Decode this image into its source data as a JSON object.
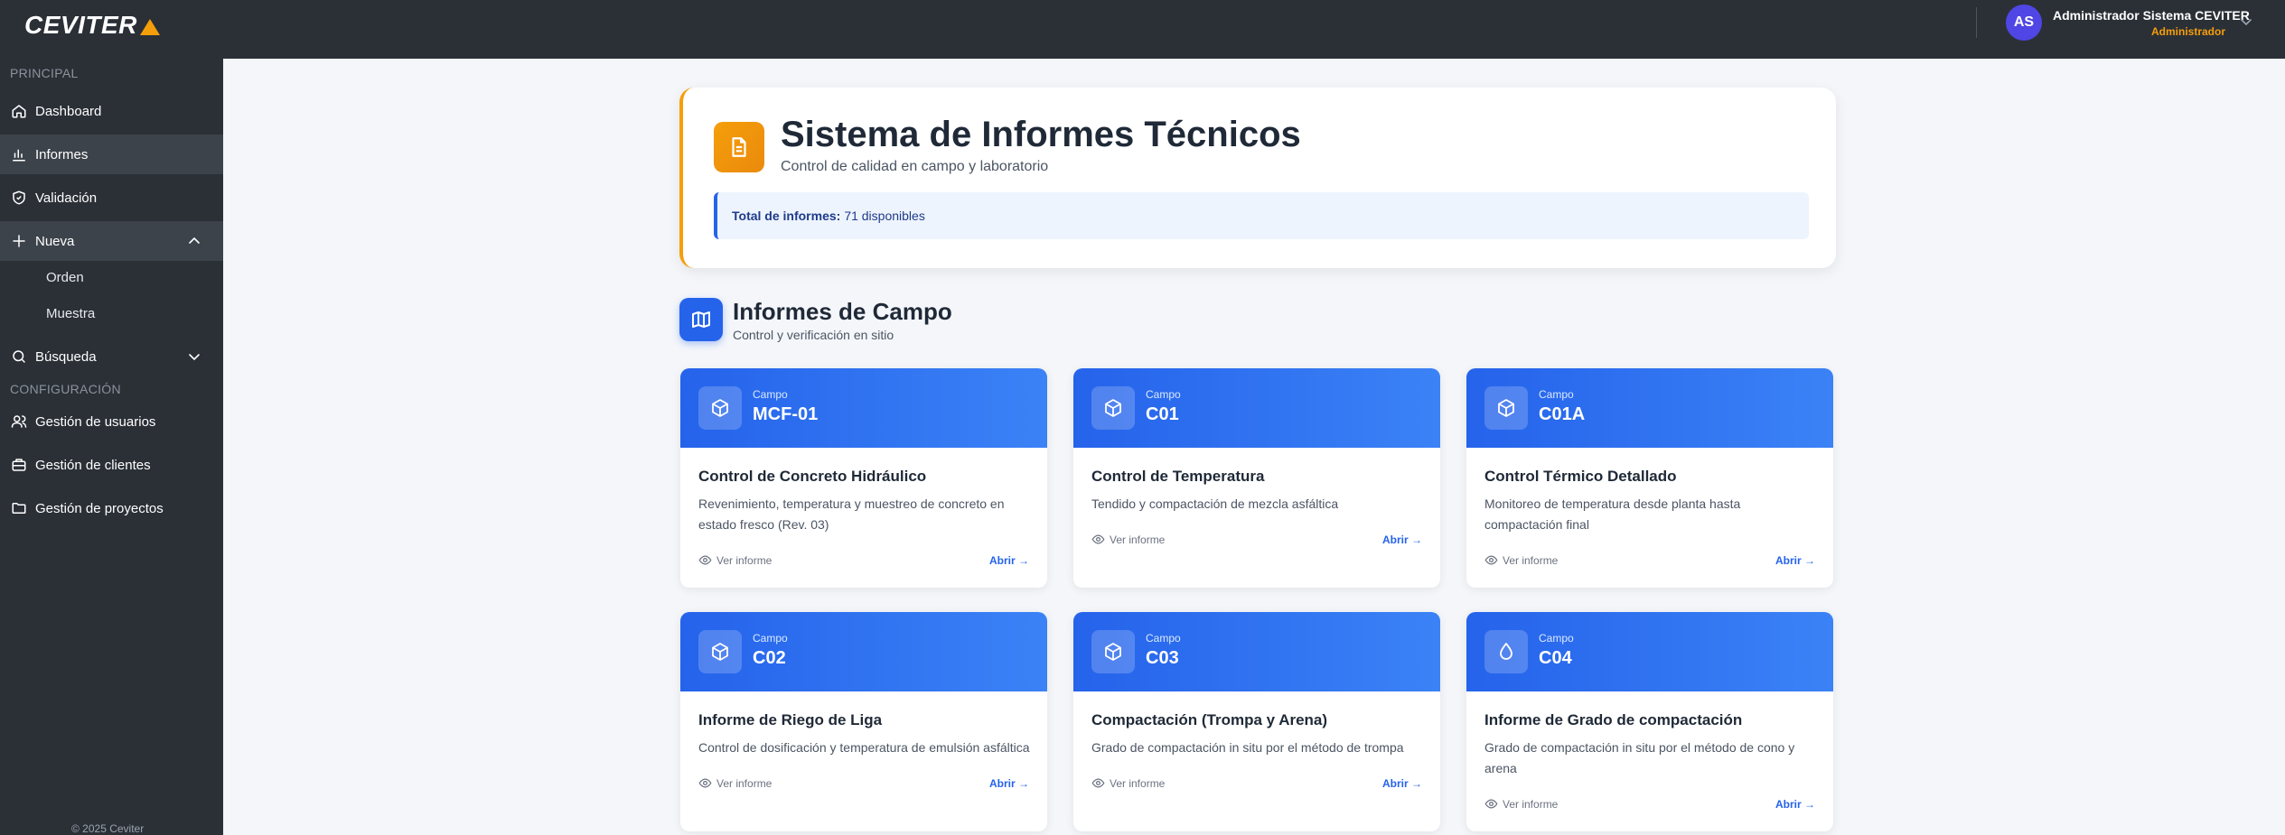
{
  "brand": {
    "name": "CEVITER"
  },
  "user": {
    "initials": "AS",
    "name": "Administrador Sistema CEVITER",
    "role": "Administrador"
  },
  "sidebar": {
    "sections": {
      "principal": "PRINCIPAL",
      "config": "CONFIGURACIÓN"
    },
    "items": [
      {
        "label": "Dashboard",
        "icon": "home-icon"
      },
      {
        "label": "Informes",
        "icon": "chart-bar-icon"
      },
      {
        "label": "Validación",
        "icon": "shield-check-icon"
      },
      {
        "label": "Nueva",
        "icon": "plus-icon"
      },
      {
        "label": "Búsqueda",
        "icon": "search-icon"
      },
      {
        "label": "Gestión de usuarios",
        "icon": "users-icon"
      },
      {
        "label": "Gestión de clientes",
        "icon": "building-icon"
      },
      {
        "label": "Gestión de proyectos",
        "icon": "folder-icon"
      }
    ],
    "sub_items": [
      "Orden",
      "Muestra"
    ],
    "copyright": "© 2025 Ceviter"
  },
  "header": {
    "title": "Sistema de Informes Técnicos",
    "subtitle": "Control de calidad en campo y laboratorio",
    "total_label": "Total de informes:",
    "total_value": "71 disponibles"
  },
  "section": {
    "title": "Informes de Campo",
    "subtitle": "Control y verificación en sitio"
  },
  "cards": [
    {
      "tag": "Campo",
      "code": "MCF-01",
      "title": "Control de Concreto Hidráulico",
      "desc": "Revenimiento, temperatura y muestreo de concreto en estado fresco (Rev. 03)",
      "view": "Ver informe",
      "open": "Abrir →",
      "icon": "cube-icon"
    },
    {
      "tag": "Campo",
      "code": "C01",
      "title": "Control de Temperatura",
      "desc": "Tendido y compactación de mezcla asfáltica",
      "view": "Ver informe",
      "open": "Abrir →",
      "icon": "cube-icon"
    },
    {
      "tag": "Campo",
      "code": "C01A",
      "title": "Control Térmico Detallado",
      "desc": "Monitoreo de temperatura desde planta hasta compactación final",
      "view": "Ver informe",
      "open": "Abrir →",
      "icon": "cube-icon"
    },
    {
      "tag": "Campo",
      "code": "C02",
      "title": "Informe de Riego de Liga",
      "desc": "Control de dosificación y temperatura de emulsión asfáltica",
      "view": "Ver informe",
      "open": "Abrir →",
      "icon": "cube-icon"
    },
    {
      "tag": "Campo",
      "code": "C03",
      "title": "Compactación (Trompa y Arena)",
      "desc": "Grado de compactación in situ por el método de trompa",
      "view": "Ver informe",
      "open": "Abrir →",
      "icon": "cube-icon"
    },
    {
      "tag": "Campo",
      "code": "C04",
      "title": "Informe de Grado de compactación",
      "desc": "Grado de compactación in situ por el método de cono y arena",
      "view": "Ver informe",
      "open": "Abrir →",
      "icon": "droplet-icon"
    }
  ]
}
